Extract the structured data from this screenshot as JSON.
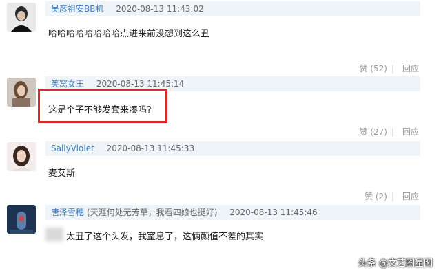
{
  "comments": [
    {
      "user": "吴彦祖安BB机",
      "note": "",
      "time": "2020-08-13 11:43:02",
      "text": "哈哈哈哈哈哈哈哈点进来前没想到这么丑",
      "like_label": "赞 (52)",
      "reply_label": "回应"
    },
    {
      "user": "笑窝女王",
      "note": "",
      "time": "2020-08-13 11:45:14",
      "text": "这是个子不够发套来凑吗?",
      "like_label": "赞 (27)",
      "reply_label": "回应"
    },
    {
      "user": "SallyViolet",
      "note": "",
      "time": "2020-08-13 11:45:33",
      "text": "麦艾斯",
      "like_label": "赞 (2)",
      "reply_label": "回应"
    },
    {
      "user": "唐泽雪穗",
      "note": "(天涯何处无芳草，我看四娘也挺好)",
      "time": "2020-08-13 11:45:46",
      "text": "太丑了这个头发，我窒息了，这俩颜值不差的其实",
      "like_label": "",
      "reply_label": ""
    }
  ],
  "watermark": "头条 @文艺圈星图",
  "colors": {
    "meta_bg": "#eef4f7",
    "username": "#3d7bbf",
    "highlight": "#d92b2b"
  }
}
